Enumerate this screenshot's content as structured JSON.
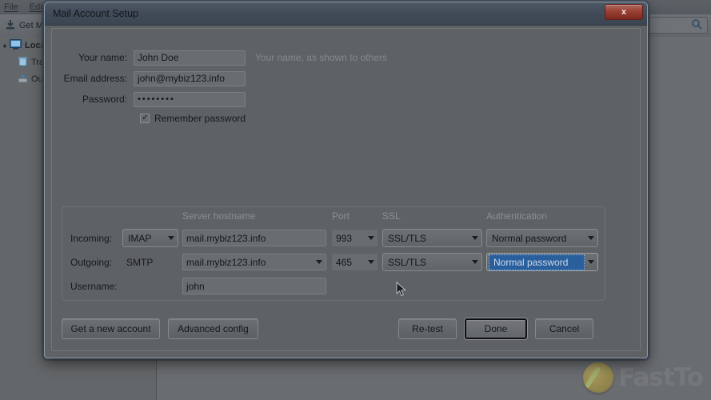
{
  "background": {
    "menus": [
      "File",
      "Edit"
    ],
    "toolbar": {
      "get_mail_label": "Get M",
      "get_mail_icon": "download-icon"
    },
    "search": {
      "placeholder": "",
      "icon": "search-icon"
    },
    "folders": [
      {
        "label": "Loca",
        "icon": "local-folders-icon",
        "level": 1,
        "bold": true
      },
      {
        "label": "Tra",
        "icon": "trash-icon",
        "level": 2,
        "bold": false
      },
      {
        "label": "Ou",
        "icon": "outbox-icon",
        "level": 2,
        "bold": false
      }
    ],
    "watermark": {
      "text": "FastTo",
      "icon": "gold-disk-icon"
    }
  },
  "dialog": {
    "title": "Mail Account Setup",
    "close_label": "x",
    "close_icon": "close-icon",
    "account": {
      "name": {
        "label": "Your name:",
        "value": "John Doe",
        "hint": "Your name, as shown to others"
      },
      "email": {
        "label": "Email address:",
        "value": "john@mybiz123.info"
      },
      "password": {
        "label": "Password:",
        "value": "••••••••"
      },
      "remember": {
        "label": "Remember password",
        "checked": true
      }
    },
    "server": {
      "headers": {
        "hostname": "Server hostname",
        "port": "Port",
        "ssl": "SSL",
        "auth": "Authentication"
      },
      "incoming": {
        "label": "Incoming:",
        "protocol": "IMAP",
        "hostname": "mail.mybiz123.info",
        "port": "993",
        "ssl": "SSL/TLS",
        "auth": "Normal password"
      },
      "outgoing": {
        "label": "Outgoing:",
        "protocol": "SMTP",
        "hostname": "mail.mybiz123.info",
        "port": "465",
        "ssl": "SSL/TLS",
        "auth": "Normal password"
      },
      "username": {
        "label": "Username:",
        "value": "john"
      }
    },
    "buttons": {
      "get_new_account": "Get a new account",
      "advanced_config": "Advanced config",
      "retest": "Re-test",
      "done": "Done",
      "cancel": "Cancel"
    }
  },
  "colors": {
    "dialog_bg": "#5f6265",
    "titlebar": "#414b57",
    "close_red": "#9a3f33",
    "selection_blue": "#2a5f9e",
    "text": "#16191c",
    "hint_text": "#84888c"
  }
}
